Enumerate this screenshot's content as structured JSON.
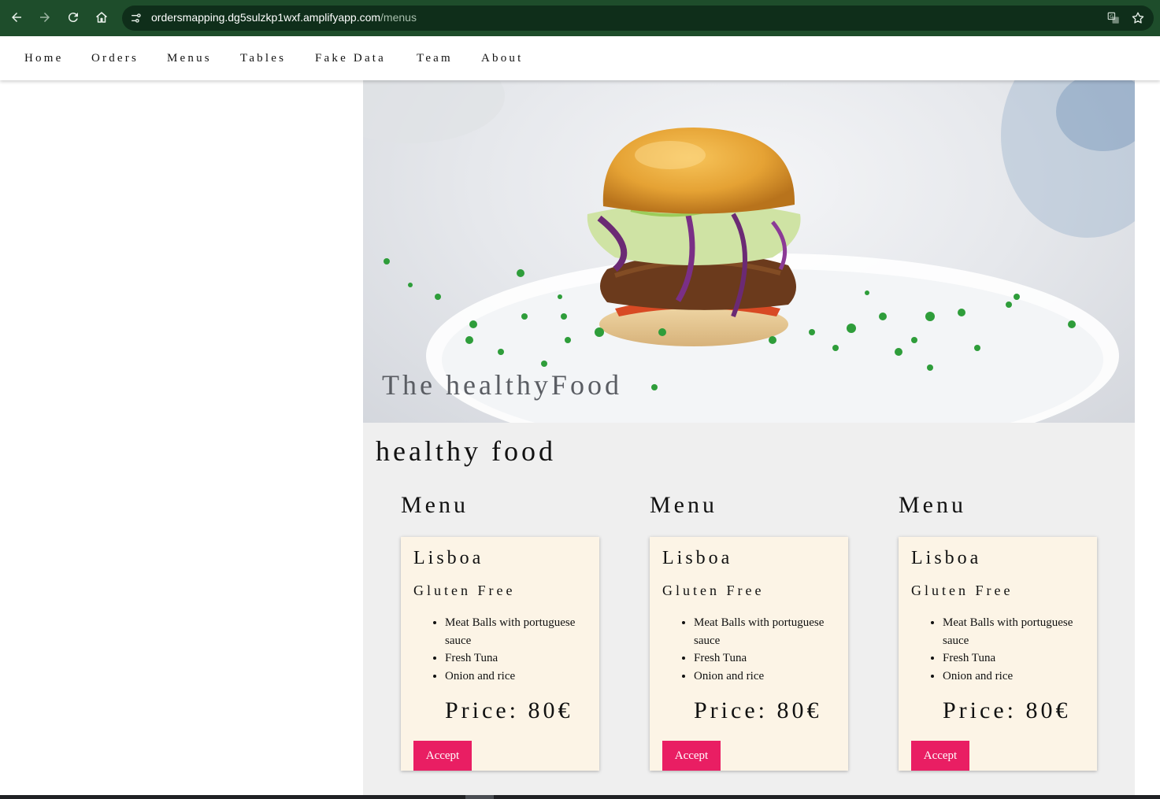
{
  "browser": {
    "url_host": "ordersmapping.dg5sulzkp1wxf.amplifyapp.com",
    "url_path": "/menus",
    "icons": [
      "back-icon",
      "forward-icon",
      "reload-icon",
      "home-icon",
      "site-info-icon",
      "translate-icon",
      "star-icon"
    ]
  },
  "nav": {
    "items": [
      {
        "label": "Home"
      },
      {
        "label": "Orders"
      },
      {
        "label": "Menus"
      },
      {
        "label": "Tables"
      },
      {
        "label": "Fake Data"
      },
      {
        "label": "Team"
      },
      {
        "label": "About"
      }
    ]
  },
  "hero": {
    "caption": "The healthyFood"
  },
  "section": {
    "title": "healthy food"
  },
  "menus": [
    {
      "heading": "Menu",
      "title": "Lisboa",
      "subtitle": "Gluten Free",
      "items": [
        "Meat Balls with portuguese sauce",
        "Fresh Tuna",
        "Onion and rice"
      ],
      "price": "Price: 80€",
      "button": "Accept"
    },
    {
      "heading": "Menu",
      "title": "Lisboa",
      "subtitle": "Gluten Free",
      "items": [
        "Meat Balls with portuguese sauce",
        "Fresh Tuna",
        "Onion and rice"
      ],
      "price": "Price: 80€",
      "button": "Accept"
    },
    {
      "heading": "Menu",
      "title": "Lisboa",
      "subtitle": "Gluten Free",
      "items": [
        "Meat Balls with portuguese sauce",
        "Fresh Tuna",
        "Onion and rice"
      ],
      "price": "Price: 80€",
      "button": "Accept"
    }
  ],
  "colors": {
    "browser_bar": "#1e4d2b",
    "accent_button": "#e91e63",
    "card_background": "#fcf4e6",
    "content_background": "#efefef"
  }
}
